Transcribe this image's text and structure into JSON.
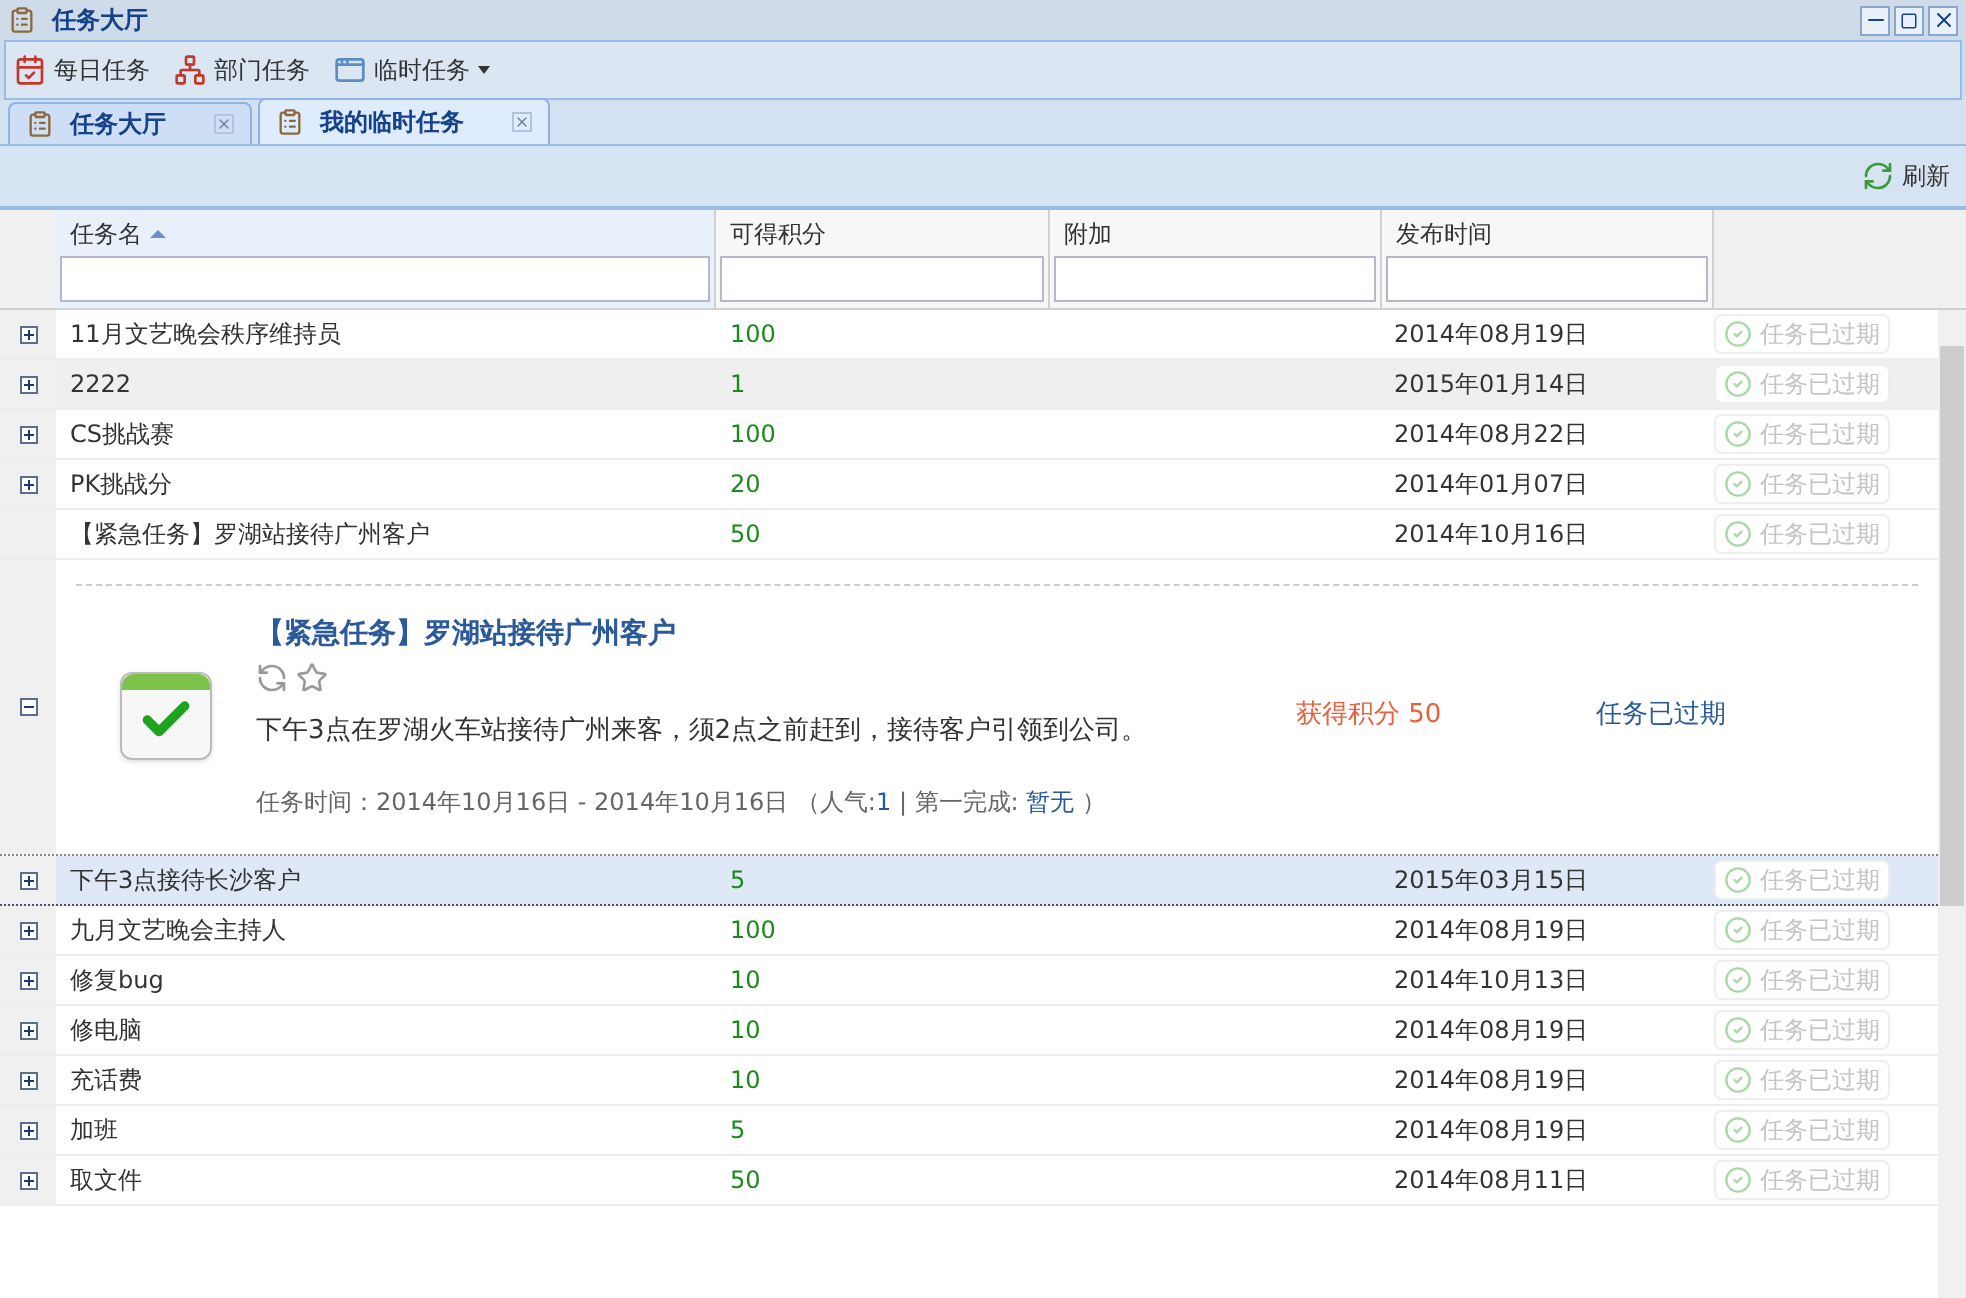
{
  "window": {
    "title": "任务大厅"
  },
  "toolbar": [
    {
      "label": "每日任务",
      "kind": "calendar",
      "has_menu": false
    },
    {
      "label": "部门任务",
      "kind": "org",
      "has_menu": false
    },
    {
      "label": "临时任务",
      "kind": "window",
      "has_menu": true
    }
  ],
  "tabs": [
    {
      "label": "任务大厅",
      "selected": false
    },
    {
      "label": "我的临时任务",
      "selected": true
    }
  ],
  "refresh_button": {
    "label": "刷新"
  },
  "table": {
    "columns": [
      {
        "label": "任务名",
        "sorted": true
      },
      {
        "label": "可得积分",
        "sorted": false
      },
      {
        "label": "附加",
        "sorted": false
      },
      {
        "label": "发布时间",
        "sorted": false
      }
    ],
    "rows": [
      {
        "name": "11月文艺晚会秩序维持员",
        "points": "100",
        "date": "2014年08月19日",
        "status": "任务已过期",
        "status_disabled": true,
        "expanded": false,
        "hovered": false,
        "selected": false
      },
      {
        "name": "2222",
        "points": "1",
        "date": "2015年01月14日",
        "status": "任务已过期",
        "status_disabled": true,
        "expanded": false,
        "hovered": true,
        "selected": false
      },
      {
        "name": "CS挑战赛",
        "points": "100",
        "date": "2014年08月22日",
        "status": "任务已过期",
        "status_disabled": true,
        "expanded": false,
        "hovered": false,
        "selected": false
      },
      {
        "name": "PK挑战分",
        "points": "20",
        "date": "2014年01月07日",
        "status": "任务已过期",
        "status_disabled": true,
        "expanded": false,
        "hovered": false,
        "selected": false
      },
      {
        "name": "【紧急任务】罗湖站接待广州客户",
        "points": "50",
        "date": "2014年10月16日",
        "status": "任务已过期",
        "status_disabled": true,
        "expanded": true,
        "hovered": false,
        "selected": false,
        "detail": {
          "title": "【紧急任务】罗湖站接待广州客户",
          "description": "下午3点在罗湖火车站接待广州来客，须2点之前赶到，接待客户引领到公司。",
          "reward": "获得积分 50",
          "status": "任务已过期",
          "time_prefix": "任务时间：2014年10月16日 - 2014年10月16日 （人气:",
          "popularity": "1",
          "separator": " | 第一完成: ",
          "first_done": "暂无",
          "suffix": " ）"
        }
      },
      {
        "name": "下午3点接待长沙客户",
        "points": "5",
        "date": "2015年03月15日",
        "status": "任务已过期",
        "status_disabled": true,
        "expanded": false,
        "hovered": false,
        "selected": true
      },
      {
        "name": "九月文艺晚会主持人",
        "points": "100",
        "date": "2014年08月19日",
        "status": "任务已过期",
        "status_disabled": true,
        "expanded": false,
        "hovered": false,
        "selected": false
      },
      {
        "name": "修复bug",
        "points": "10",
        "date": "2014年10月13日",
        "status": "任务已过期",
        "status_disabled": true,
        "expanded": false,
        "hovered": false,
        "selected": false
      },
      {
        "name": "修电脑",
        "points": "10",
        "date": "2014年08月19日",
        "status": "任务已过期",
        "status_disabled": true,
        "expanded": false,
        "hovered": false,
        "selected": false
      },
      {
        "name": "充话费",
        "points": "10",
        "date": "2014年08月19日",
        "status": "任务已过期",
        "status_disabled": true,
        "expanded": false,
        "hovered": false,
        "selected": false
      },
      {
        "name": "加班",
        "points": "5",
        "date": "2014年08月19日",
        "status": "任务已过期",
        "status_disabled": true,
        "expanded": false,
        "hovered": false,
        "selected": false
      },
      {
        "name": "取文件",
        "points": "50",
        "date": "2014年08月11日",
        "status": "任务已过期",
        "status_disabled": true,
        "expanded": false,
        "hovered": false,
        "selected": false
      }
    ]
  }
}
